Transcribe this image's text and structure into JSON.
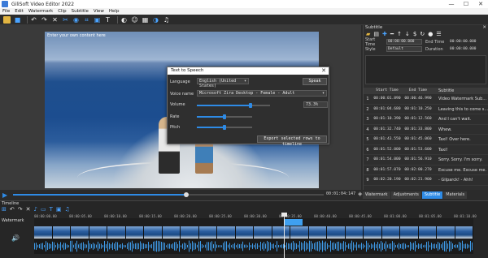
{
  "app": {
    "title": "GiliSoft Video Editor 2022"
  },
  "window_controls": {
    "minimize": "—",
    "maximize": "☐",
    "close": "✕"
  },
  "menu": [
    "File",
    "Edit",
    "Watermark",
    "Clip",
    "Subtitle",
    "View",
    "Help"
  ],
  "toolbar": {
    "icons": [
      "open-folder-icon",
      "save-icon",
      "undo-icon",
      "redo-icon",
      "delete-icon",
      "cut-icon",
      "snapshot-icon",
      "crop-icon",
      "text-icon",
      "image-icon",
      "color-icon",
      "sticker-icon",
      "mosaic-icon",
      "speed-icon",
      "audio-icon"
    ]
  },
  "preview": {
    "overlay_text": "Enter your own content here"
  },
  "transport": {
    "time": "00:01:04:147",
    "progress": 0.555
  },
  "right_tabs": {
    "items": [
      "Watermark",
      "Adjustments",
      "Subtitle",
      "Materials"
    ],
    "active": "Subtitle"
  },
  "subtitle_panel": {
    "title": "Subtitle",
    "start_time_label": "Start Time",
    "start_time_value": "00:00:00.000",
    "end_time_label": "End Time",
    "end_time_value": "00:00:00.000",
    "style_label": "Style",
    "style_value": "Default",
    "duration_label": "Duration",
    "duration_value": "00:00:00.000",
    "columns": [
      "",
      "Start Time",
      "End Time",
      "Subtitle"
    ],
    "rows": [
      {
        "n": "1",
        "start": "00:00:01.890",
        "end": "00:00:46.990",
        "text": "Video Watermark Sub..."
      },
      {
        "n": "2",
        "start": "00:01:04.680",
        "end": "00:01:10.250",
        "text": "Leaving this to come s..."
      },
      {
        "n": "3",
        "start": "00:01:10.390",
        "end": "00:01:12.560",
        "text": "And I can't wait."
      },
      {
        "n": "4",
        "start": "00:01:32.740",
        "end": "00:01:33.800",
        "text": "Whew."
      },
      {
        "n": "5",
        "start": "00:01:43.550",
        "end": "00:01:45.060",
        "text": "Taxi! Over here."
      },
      {
        "n": "6",
        "start": "00:01:52.000",
        "end": "00:01:53.600",
        "text": "Taxi!"
      },
      {
        "n": "7",
        "start": "00:01:54.000",
        "end": "00:01:56.910",
        "text": "Sorry. Sorry. I'm sorry."
      },
      {
        "n": "8",
        "start": "00:01:57.070",
        "end": "00:02:00.270",
        "text": "Excuse me. Excuse me."
      },
      {
        "n": "9",
        "start": "00:02:20.190",
        "end": "00:02:21.900",
        "text": "- Gilparck! - Ahh!"
      }
    ]
  },
  "dialog": {
    "title": "Text to Speech",
    "close": "✕",
    "language_label": "Language",
    "language_value": "English (United States)",
    "speak_button": "Speak",
    "voice_label": "Voice name",
    "voice_value": "Microsoft Zira Desktop - Female - Adult",
    "volume_label": "Volume",
    "volume_value": "73.3%",
    "volume_level": 0.733,
    "rate_label": "Rate",
    "rate_level": 0.5,
    "pitch_label": "Pitch",
    "pitch_level": 0.5,
    "export_button": "Export selected rows to timeline"
  },
  "timeline": {
    "title": "Timeline",
    "watermark_label": "Watermark",
    "ruler": [
      "00:00:00.00",
      "00:00:05.00",
      "00:00:10.00",
      "00:00:15.00",
      "00:00:20.00",
      "00:00:25.00",
      "00:00:30.00",
      "00:00:35.00",
      "00:00:40.00",
      "00:00:45.00",
      "00:01:00.00",
      "00:01:05.00",
      "00:01:10.00"
    ],
    "tools": [
      "split-icon",
      "undo-icon",
      "redo-icon",
      "delete-icon",
      "mic-icon",
      "subtitle-icon",
      "add-text-icon",
      "image-icon",
      "music-icon"
    ]
  },
  "colors": {
    "accent": "#2e8be6",
    "panel": "#2b2b2b",
    "selected_row": "#2a4d70"
  }
}
